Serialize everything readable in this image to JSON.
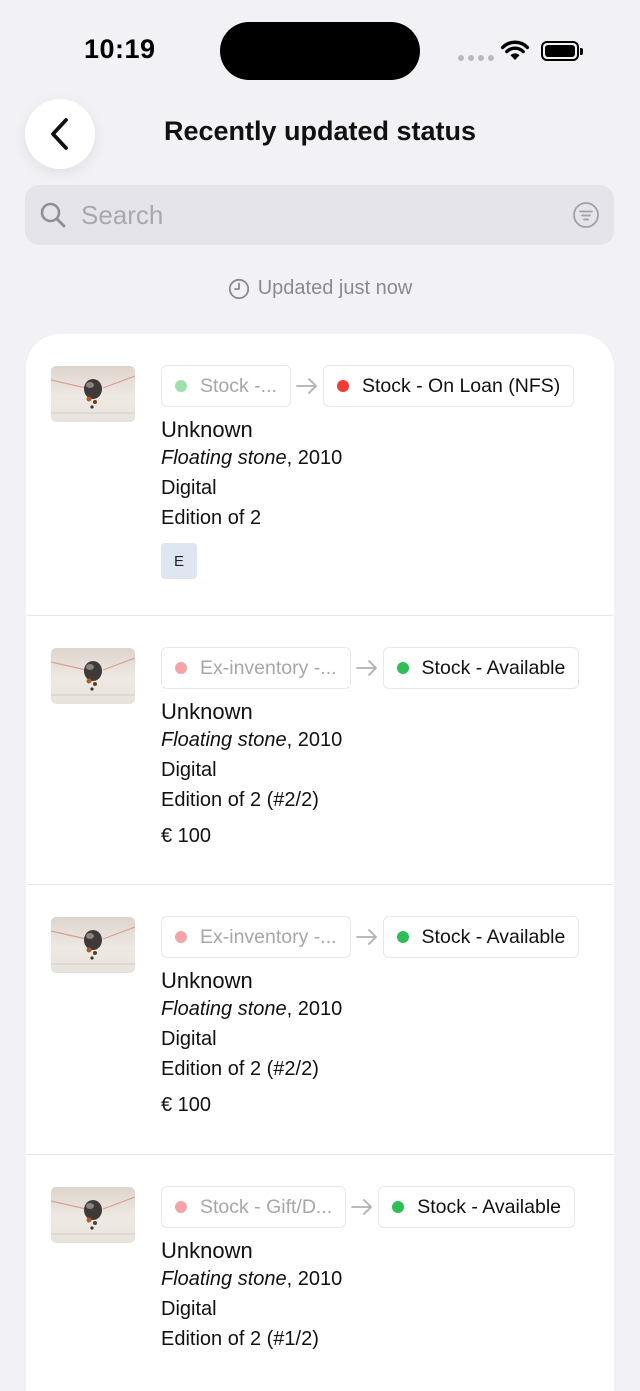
{
  "status_bar": {
    "time": "10:19"
  },
  "header": {
    "title": "Recently updated status"
  },
  "search": {
    "placeholder": "Search"
  },
  "updated_text": "Updated just now",
  "colors": {
    "green": "#34c759",
    "red": "#ff3b30",
    "badge_bg": "#dfe6f1"
  },
  "items": [
    {
      "from_status": "Stock -...",
      "from_color": "#9fdfae",
      "to_status": "Stock - On Loan (NFS)",
      "to_color": "#f23a34",
      "artist": "Unknown",
      "title": "Floating stone",
      "year_suffix": ", 2010",
      "medium": "Digital",
      "edition": "Edition of 2",
      "badge": "E"
    },
    {
      "from_status": "Ex-inventory -...",
      "from_color": "#f4a3a8",
      "to_status": "Stock - Available",
      "to_color": "#2dbe55",
      "artist": "Unknown",
      "title": "Floating stone",
      "year_suffix": ", 2010",
      "medium": "Digital",
      "edition": "Edition of 2 (#2/2)",
      "price": "€ 100"
    },
    {
      "from_status": "Ex-inventory -...",
      "from_color": "#f4a3a8",
      "to_status": "Stock - Available",
      "to_color": "#2dbe55",
      "artist": "Unknown",
      "title": "Floating stone",
      "year_suffix": ", 2010",
      "medium": "Digital",
      "edition": "Edition of 2 (#2/2)",
      "price": "€ 100"
    },
    {
      "from_status": "Stock - Gift/D...",
      "from_color": "#f4a3a8",
      "to_status": "Stock - Available",
      "to_color": "#2dbe55",
      "artist": "Unknown",
      "title": "Floating stone",
      "year_suffix": ", 2010",
      "medium": "Digital",
      "edition": "Edition of 2 (#1/2)"
    }
  ]
}
